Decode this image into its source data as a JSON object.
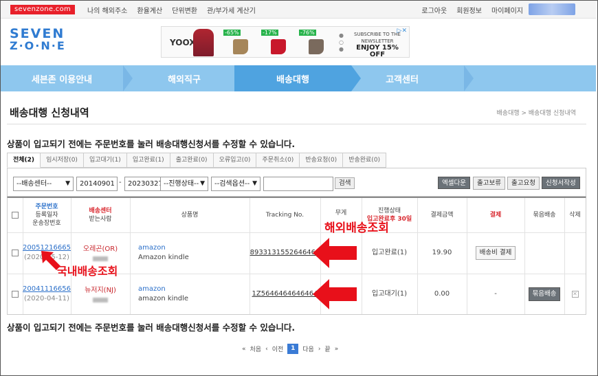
{
  "topbar": {
    "site": "sevenzone.com",
    "links": [
      "나의 해외주소",
      "환율계산",
      "단위변환",
      "관/부가세 계산기"
    ],
    "user_links": [
      "로그아웃",
      "회원정보",
      "마이페이지"
    ]
  },
  "logo": {
    "line1": "SEVEN",
    "line2": "Z·O·N·E"
  },
  "ad": {
    "brand": "YOOX",
    "discounts": [
      "-65%",
      "-17%",
      "-76%"
    ],
    "subscribe": "SUBSCRIBE TO THE NEWSLETTER",
    "offer": "ENJOY 15% OFF"
  },
  "nav": {
    "items": [
      "세븐존 이용안내",
      "해외직구",
      "배송대행",
      "고객센터"
    ],
    "active_index": 2
  },
  "page": {
    "title": "배송대행 신청내역",
    "breadcrumb": "배송대행 > 배송대행 신청내역",
    "notice": "상품이 입고되기 전에는 주문번호를 눌러 배송대행신청서를 수정할 수 있습니다."
  },
  "tabs": [
    "전체(2)",
    "임시저장(0)",
    "입고대기(1)",
    "입고완료(1)",
    "출고완료(0)",
    "오류입고(0)",
    "주문취소(0)",
    "반송요청(0)",
    "반송완료(0)"
  ],
  "filters": {
    "center": "--배송센터--",
    "date_from": "20140901",
    "date_sep": "-",
    "date_to": "20230327",
    "status": "--진행상태--",
    "search_option": "--검색옵션--",
    "search_value": "",
    "search_button": "검색",
    "actions": [
      "엑셀다운",
      "출고보류",
      "출고요청",
      "신청서작성"
    ]
  },
  "table": {
    "headers": {
      "order": [
        "주문번호",
        "등록일자",
        "운송장번호"
      ],
      "center": [
        "배송센터",
        "받는사람"
      ],
      "product": "상품명",
      "tracking": "Tracking No.",
      "weight": "무게",
      "status": [
        "진행상태",
        "입고완료후 30일"
      ],
      "amount": "결제금액",
      "pay": "결제",
      "consolidate": "묶음배송",
      "delete": "삭제"
    },
    "rows": [
      {
        "order_no": "20051216665",
        "date": "(2020-05-12)",
        "center": "오레곤(OR)",
        "brand": "amazon",
        "product": "Amazon kindle",
        "tracking": "8933131552646464",
        "status": "입고완료(1)",
        "amount": "19.90",
        "pay_button": "배송비 결제",
        "consolidate": ""
      },
      {
        "order_no": "20041116656",
        "date": "(2020-04-11)",
        "center": "뉴저지(NJ)",
        "brand": "amazon",
        "product": "amazon kindle",
        "tracking": "1Z5646464646464",
        "status": "입고대기(1)",
        "amount": "0.00",
        "pay_button": "-",
        "consolidate": "묶음배송"
      }
    ]
  },
  "annotations": {
    "overseas": "해외배송조회",
    "domestic": "국내배송조회"
  },
  "pager": {
    "first": "처음",
    "prev": "이전",
    "current": "1",
    "next": "다음",
    "last": "끝"
  },
  "colors": {
    "accent": "#4fa3e0",
    "nav": "#8ec7ee",
    "red": "#e8101a",
    "link": "#2a6fc9"
  }
}
